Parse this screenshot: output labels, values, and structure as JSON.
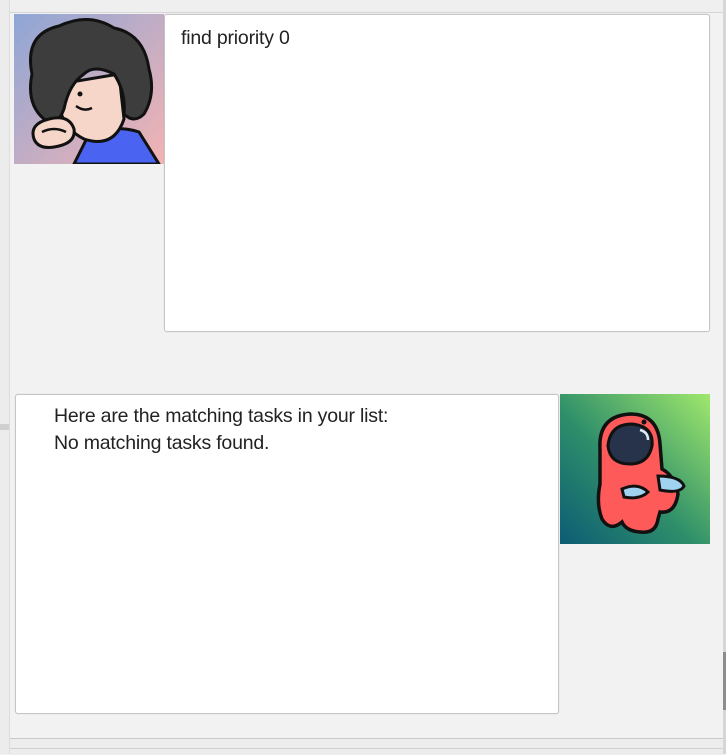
{
  "conversation": {
    "user_message": {
      "text": "find priority 0",
      "avatar_icon": "user-cartoon-avatar"
    },
    "bot_message": {
      "lines": [
        "Here are the matching tasks in your list:",
        "No matching tasks found."
      ],
      "avatar_icon": "red-crewmate-avatar"
    }
  },
  "colors": {
    "background": "#f2f2f2",
    "bubble": "#ffffff",
    "text": "#222222",
    "user_avatar_bg_top": "#8ea6d6",
    "user_avatar_bg_bottom": "#f3b3b3",
    "bot_avatar_bg_top": "#a0e86c",
    "bot_avatar_bg_bottom": "#0c5c74",
    "crewmate_red": "#ff5a5a"
  }
}
